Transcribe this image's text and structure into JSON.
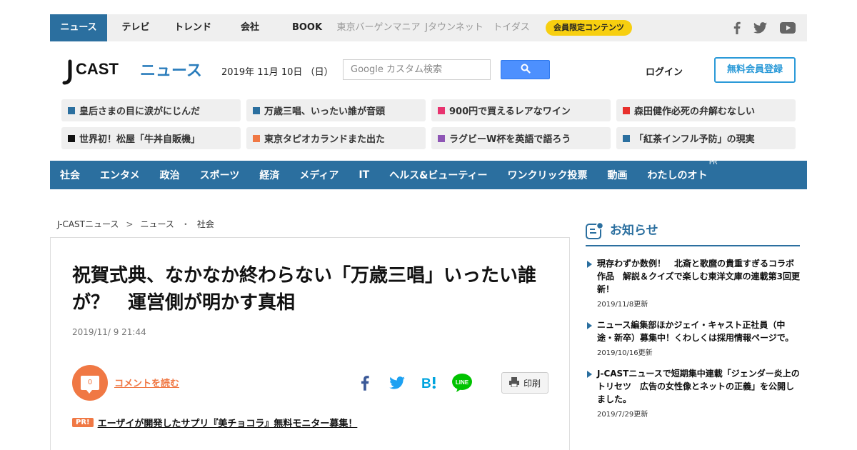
{
  "topbar": {
    "items": [
      {
        "label": "ニュース",
        "active": true
      },
      {
        "label": "テレビ"
      },
      {
        "label": "トレンド"
      },
      {
        "label": "会社"
      },
      {
        "label": "BOOK"
      },
      {
        "label": "東京バーゲンマニア",
        "gray": true
      },
      {
        "label": "Jタウンネット",
        "gray": true
      },
      {
        "label": "トイダス",
        "gray": true
      }
    ],
    "member_label": "会員限定コンテンツ",
    "social_icons": [
      "facebook-icon",
      "twitter-icon",
      "youtube-icon"
    ]
  },
  "header": {
    "logo_text": "J-CAST ニュース",
    "date": "2019年 11月 10日 （日）",
    "search_placeholder": "Google カスタム検索",
    "login_label": "ログイン",
    "register_label": "無料会員登録"
  },
  "topics": [
    {
      "label": "皇后さまの目に涙がにじんだ",
      "color": "#2b6f9f"
    },
    {
      "label": "万歳三唱、いったい誰が音頭",
      "color": "#2b6f9f"
    },
    {
      "label": "900円で買えるレアなワイン",
      "color": "#e8336f"
    },
    {
      "label": "森田健作必死の弁解むなしい",
      "color": "#e8302c"
    },
    {
      "label": "世界初！松屋「牛丼自販機」",
      "color": "#111111"
    },
    {
      "label": "東京タピオカランドまた出た",
      "color": "#f07844"
    },
    {
      "label": "ラグビーW杯を英語で語ろう",
      "color": "#8e55b5"
    },
    {
      "label": "「紅茶インフル予防」の現実",
      "color": "#2b6f9f"
    }
  ],
  "categories": [
    "社会",
    "エンタメ",
    "政治",
    "スポーツ",
    "経済",
    "メディア",
    "IT",
    "ヘルス&ビューティー",
    "ワンクリック投票",
    "動画",
    "わたしのオト"
  ],
  "category_pr": "PR",
  "breadcrumb": [
    "J-CASTニュース",
    "ニュース",
    "社会"
  ],
  "breadcrumb_seps": [
    ">",
    "・"
  ],
  "article": {
    "headline": "祝賀式典、なかなか終わらない「万歳三唱」いったい誰が？　運営側が明かす真相",
    "date": "2019/11/ 9 21:44",
    "comment_count": "0",
    "comment_label": "コメントを読む",
    "print_label": "印刷",
    "pr_badge": "PR!",
    "pr_text": "エーザイが開発したサプリ『美チョコラ』無料モニター募集！",
    "share_icons": [
      "facebook-share-icon",
      "twitter-share-icon",
      "hatena-bookmark-icon",
      "line-share-icon"
    ]
  },
  "sidebar": {
    "title": "お知らせ",
    "items": [
      {
        "title": "現存わずか数例！　北斎と歌麿の貴重すぎるコラボ作品　解説＆クイズで楽しむ東洋文庫の連載第3回更新！",
        "date": "2019/11/8更新"
      },
      {
        "title": "ニュース編集部ほかジェイ・キャスト正社員（中途・新卒）募集中！くわしくは採用情報ページで。",
        "date": "2019/10/16更新"
      },
      {
        "title": "J-CASTニュースで短期集中連載「ジェンダー炎上のトリセツ　広告の女性像とネットの正義」を公開しました。",
        "date": "2019/7/29更新"
      }
    ]
  }
}
